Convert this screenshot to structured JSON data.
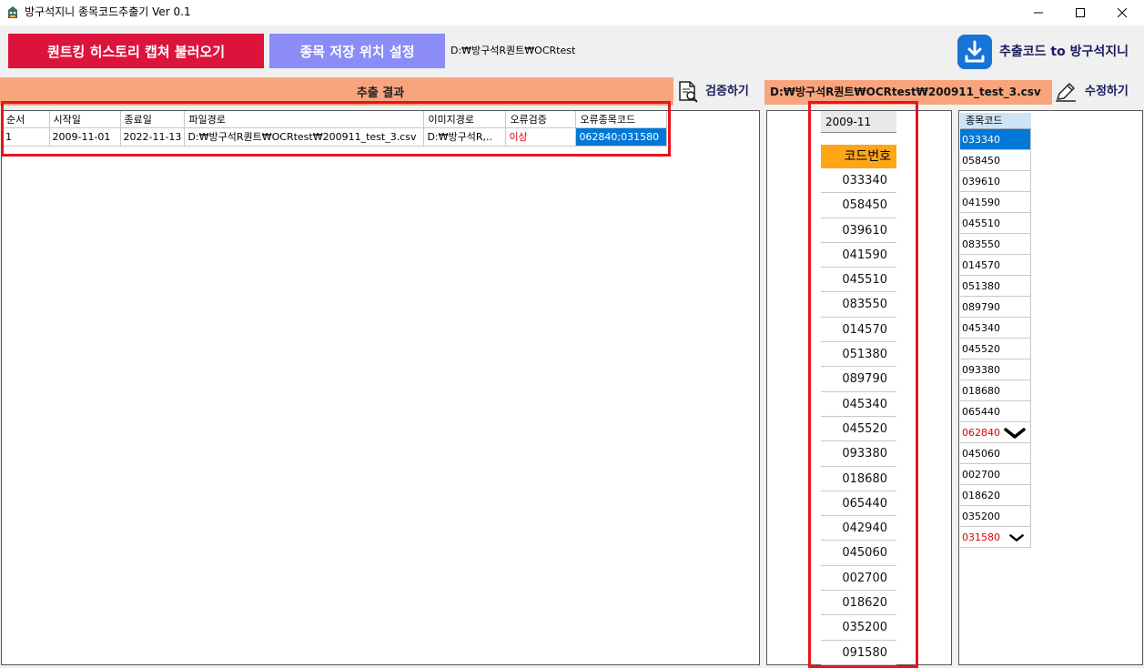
{
  "window": {
    "title": "방구석지니 종목코드추출기 Ver 0.1",
    "minimize_icon": "minimize-icon",
    "maximize_icon": "maximize-icon",
    "close_icon": "close-icon"
  },
  "toolbar": {
    "load_button": "퀀트킹 히스토리 캡쳐 불러오기",
    "location_button": "종목 저장 위치 설정",
    "save_path": "D:₩방구석R퀀트₩OCRtest",
    "export_label": "추출코드 to 방구석지니",
    "export_icon": "download-icon"
  },
  "result": {
    "header": "추출 결과",
    "verify_label": "검증하기",
    "verify_icon": "document-search-icon",
    "csv_path": "D:₩방구석R퀀트₩OCRtest₩200911_test_3.csv",
    "edit_label": "수정하기",
    "edit_icon": "pencil-icon",
    "columns": [
      "순서",
      "시작일",
      "종료일",
      "파일경로",
      "이미지경로",
      "오류검증",
      "오류종목코드"
    ],
    "rows": [
      [
        "1",
        "2009-11-01",
        "2022-11-13",
        "D:₩방구석R퀀트₩OCRtest₩200911_test_3.csv",
        "D:₩방구석R,..",
        "이상",
        "062840;031580"
      ]
    ]
  },
  "codes": {
    "month": "2009-11",
    "header": "코드번호",
    "items": [
      "033340",
      "058450",
      "039610",
      "041590",
      "045510",
      "083550",
      "014570",
      "051380",
      "089790",
      "045340",
      "045520",
      "093380",
      "018680",
      "065440",
      "042940",
      "045060",
      "002700",
      "018620",
      "035200",
      "091580"
    ]
  },
  "stock_codes": {
    "header": "종목코드",
    "items": [
      "033340",
      "058450",
      "039610",
      "041590",
      "045510",
      "083550",
      "014570",
      "051380",
      "089790",
      "045340",
      "045520",
      "093380",
      "018680",
      "065440",
      "062840",
      "045060",
      "002700",
      "018620",
      "035200",
      "031580"
    ],
    "selected_index": 0,
    "error_indices": [
      14,
      19
    ]
  },
  "colors": {
    "load_button": "#dc143c",
    "location_button": "#8b8cf5",
    "header_bg": "#f8a57e",
    "code_header_bg": "#ffa518",
    "selection": "#0078d7",
    "highlight_box": "#e8141b"
  }
}
